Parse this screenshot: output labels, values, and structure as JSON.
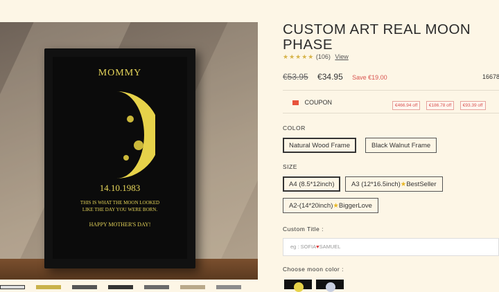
{
  "product": {
    "title": "CUSTOM ART REAL MOON PHASE",
    "stars": "★★★★★",
    "review_count": "(106)",
    "view_label": "View",
    "old_price": "€53.95",
    "new_price": "€34.95",
    "save_label": "Save €19.00",
    "sold_count": "16678"
  },
  "poster": {
    "name": "MOMMY",
    "date": "14.10.1983",
    "message_line1": "THIS IS WHAT THE MOON LOOKED",
    "message_line2": "LIKE THE DAY YOU WERE BORN.",
    "closing": "HAPPY MOTHER'S DAY!"
  },
  "coupon": {
    "label": "COUPON",
    "tags": [
      "€466.94 off",
      "€186.78 off",
      "€93.39 off"
    ]
  },
  "color": {
    "label": "COLOR",
    "options": [
      "Natural Wood Frame",
      "Black Walnut Frame"
    ]
  },
  "size": {
    "label": "SIZE",
    "options": [
      {
        "text": "A4 (8.5*12inch)",
        "badge": ""
      },
      {
        "text": "A3 (12*16.5inch)",
        "badge": "BestSeller"
      },
      {
        "text": "A2-(14*20inch)",
        "badge": "BiggerLove"
      }
    ]
  },
  "custom_title": {
    "label": "Custom Title :",
    "placeholder_before": "eg : SOFIA",
    "placeholder_after": "SAMUEL"
  },
  "moon_color": {
    "label": "Choose moon color :"
  },
  "colors": {
    "accent_red": "#d9534f",
    "star_gold": "#d7b44a",
    "moon_yellow": "#e6d24a"
  }
}
